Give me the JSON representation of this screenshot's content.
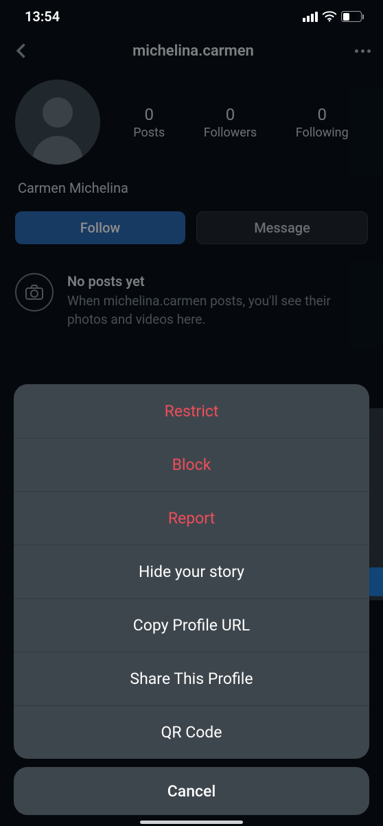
{
  "status_bar": {
    "time": "13:54",
    "battery_percent": "39",
    "battery_fill_pct": 39
  },
  "header": {
    "username": "michelina.carmen"
  },
  "profile": {
    "display_name": "Carmen Michelina",
    "stats": {
      "posts_value": "0",
      "posts_label": "Posts",
      "followers_value": "0",
      "followers_label": "Followers",
      "following_value": "0",
      "following_label": "Following"
    },
    "follow_label": "Follow",
    "message_label": "Message"
  },
  "empty_state": {
    "title": "No posts yet",
    "subtitle": "When michelina.carmen posts, you'll see their photos and videos here."
  },
  "action_sheet": {
    "items": [
      {
        "label": "Restrict",
        "destructive": true
      },
      {
        "label": "Block",
        "destructive": true
      },
      {
        "label": "Report",
        "destructive": true
      },
      {
        "label": "Hide your story",
        "destructive": false
      },
      {
        "label": "Copy Profile URL",
        "destructive": false
      },
      {
        "label": "Share This Profile",
        "destructive": false
      },
      {
        "label": "QR Code",
        "destructive": false
      }
    ],
    "cancel_label": "Cancel"
  }
}
